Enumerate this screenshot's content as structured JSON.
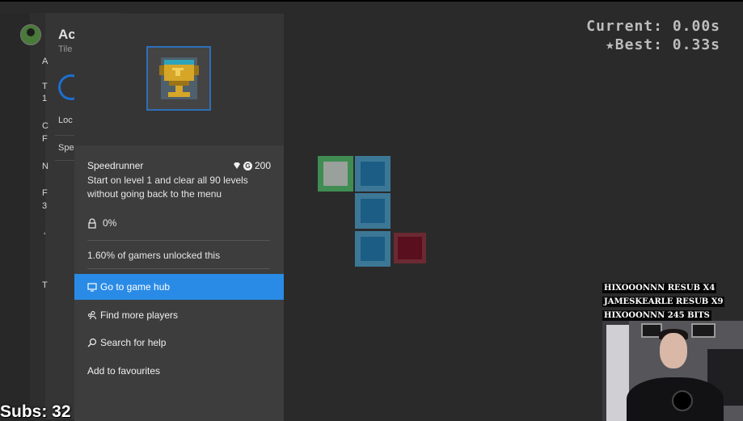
{
  "background_panel": {
    "title": "Ac",
    "subtitle": "Tile",
    "labels": [
      "A",
      "T",
      "1",
      "C",
      "F",
      "Loc",
      "Spe",
      "N",
      "F",
      "3",
      "‘",
      "T"
    ]
  },
  "achievement": {
    "name": "Speedrunner",
    "gamerscore": "200",
    "description": "Start on level 1 and clear all 90 levels without going back to the menu",
    "progress": "0%",
    "unlock_stat": "1.60% of gamers unlocked this"
  },
  "menu": {
    "items": [
      {
        "label": "Go to game hub",
        "icon": "tv-icon",
        "selected": true
      },
      {
        "label": "Find more players",
        "icon": "people-icon",
        "selected": false
      },
      {
        "label": "Search for help",
        "icon": "search-icon",
        "selected": false
      },
      {
        "label": "Add to favourites",
        "icon": "",
        "selected": false
      }
    ]
  },
  "timer": {
    "current": "Current: 0.00s",
    "best": "★Best: 0.33s"
  },
  "chat": [
    "HIXOOONNN  RESUB X4",
    "JAMESKEARLE  RESUB X9",
    "HIXOOONNN  245 BITS"
  ],
  "subs": "Subs: 32",
  "colors": {
    "accent": "#2a8be6",
    "block_green": "#3f8d52",
    "block_blue": "#1c5d85",
    "block_red": "#5a0f1e",
    "trophy_gold": "#d6a629"
  }
}
